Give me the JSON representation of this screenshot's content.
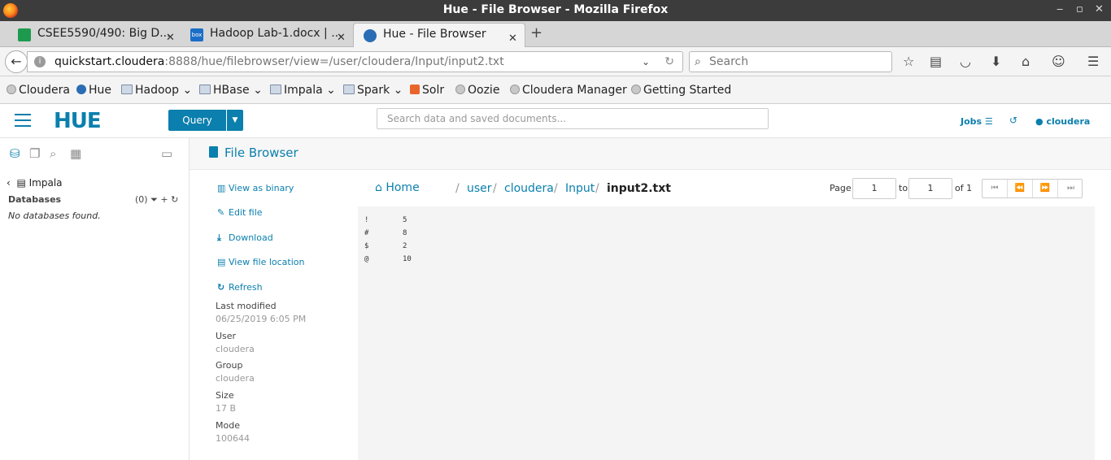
{
  "window": {
    "title": "Hue - File Browser - Mozilla Firefox",
    "controls": [
      "‒",
      "▫",
      "✕"
    ]
  },
  "tabs": [
    {
      "label": "CSEE5590/490: Big D...",
      "icon": "sheets-icon",
      "active": false
    },
    {
      "label": "Hadoop Lab-1.docx | ...",
      "icon": "box-icon",
      "active": false
    },
    {
      "label": "Hue - File Browser",
      "icon": "hue-icon",
      "active": true
    }
  ],
  "url": {
    "host": "quickstart.cloudera",
    "path": ":8888/hue/filebrowser/view=/user/cloudera/Input/input2.txt"
  },
  "search": {
    "placeholder": "Search"
  },
  "bookmarks": [
    {
      "label": "Cloudera",
      "icon": "globe-icon"
    },
    {
      "label": "Hue",
      "icon": "hue-icon"
    },
    {
      "label": "Hadoop",
      "icon": "folder-icon",
      "dropdown": true
    },
    {
      "label": "HBase",
      "icon": "folder-icon",
      "dropdown": true
    },
    {
      "label": "Impala",
      "icon": "folder-icon",
      "dropdown": true
    },
    {
      "label": "Spark",
      "icon": "folder-icon",
      "dropdown": true
    },
    {
      "label": "Solr",
      "icon": "solr-icon"
    },
    {
      "label": "Oozie",
      "icon": "globe-icon"
    },
    {
      "label": "Cloudera Manager",
      "icon": "globe-icon"
    },
    {
      "label": "Getting Started",
      "icon": "globe-icon"
    }
  ],
  "hue": {
    "logo": "HUE",
    "query_button": "Query",
    "search_placeholder": "Search data and saved documents...",
    "jobs_label": "Jobs",
    "user_label": "cloudera"
  },
  "left_panel": {
    "back_label": "Impala",
    "databases_label": "Databases",
    "databases_count": "(0)",
    "empty_text": "No databases found."
  },
  "file_browser": {
    "title": "File Browser",
    "actions": {
      "view_binary": "View as binary",
      "edit_file": "Edit file",
      "download": "Download",
      "view_location": "View file location",
      "refresh": "Refresh"
    },
    "meta": {
      "last_modified_label": "Last modified",
      "last_modified": "06/25/2019 6:05 PM",
      "user_label": "User",
      "user": "cloudera",
      "group_label": "Group",
      "group": "cloudera",
      "size_label": "Size",
      "size": "17 B",
      "mode_label": "Mode",
      "mode": "100644"
    },
    "breadcrumb": {
      "home": "Home",
      "parts": [
        "user",
        "cloudera",
        "Input"
      ],
      "current": "input2.txt"
    },
    "pagination": {
      "page_label": "Page",
      "page": "1",
      "to_label": "to",
      "to": "1",
      "of_label": "of 1"
    },
    "content_rows": [
      {
        "key": "!",
        "value": "5"
      },
      {
        "key": "#",
        "value": "8"
      },
      {
        "key": "$",
        "value": "2"
      },
      {
        "key": "@",
        "value": "10"
      }
    ]
  },
  "colors": {
    "accent": "#0b7fad",
    "titlebar": "#3c3c3c",
    "content_bg": "#f4f4f4"
  }
}
